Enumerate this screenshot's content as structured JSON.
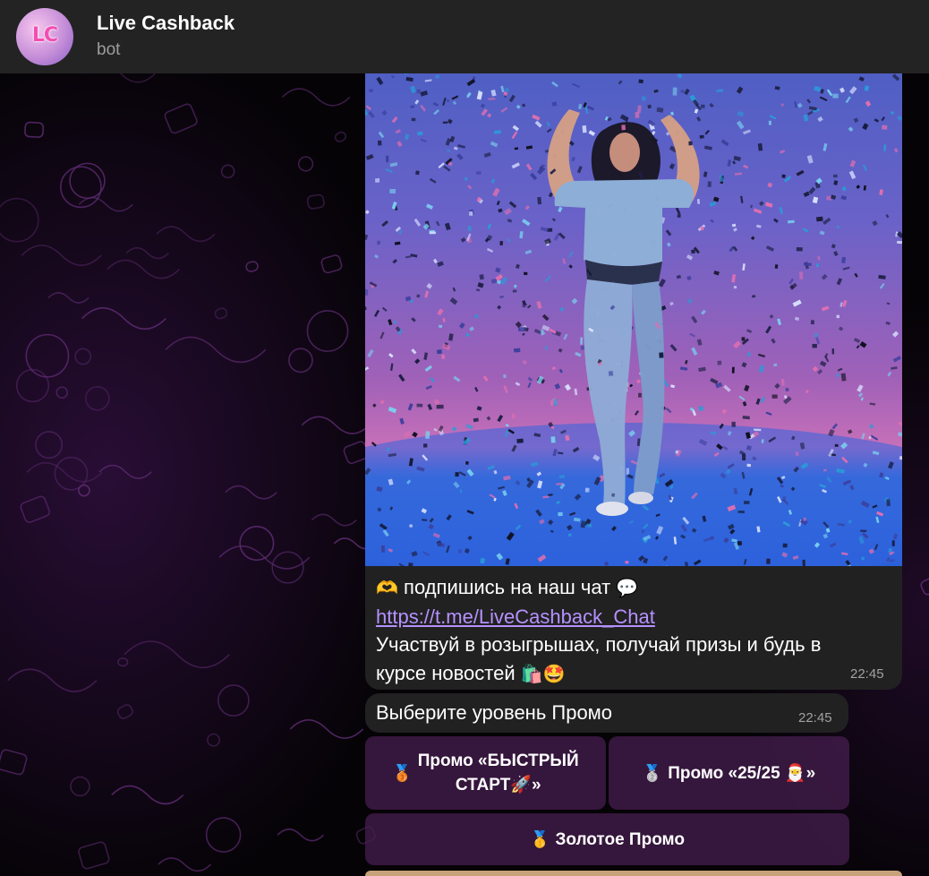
{
  "header": {
    "avatar_text": "LC",
    "title": "Live Cashback",
    "subtitle": "bot"
  },
  "photo_message": {
    "caption": {
      "line1_emoji": "🫶",
      "line1_text": "подпишись на наш чат",
      "line1_trailing_emoji": "💬",
      "link": "https://t.me/LiveCashback_Chat",
      "line3": "Участвуй в розыгрышах, получай призы и будь в",
      "line4_text": "курсе новостей",
      "line4_emoji": "🛍️🤩"
    },
    "time": "22:45"
  },
  "text_message": {
    "text": "Выберите уровень Промо",
    "time": "22:45"
  },
  "keyboard": {
    "buttons": [
      {
        "medal": "🥉",
        "label_line1": "Промо «БЫСТРЫЙ",
        "label_line2": "СТАРТ🚀»"
      },
      {
        "medal": "🥈",
        "label": "Промо «25/25 🎅»"
      },
      {
        "medal": "🥇",
        "label": "Золотое Промо"
      }
    ]
  },
  "colors": {
    "header_bg": "#232323",
    "bubble_bg": "#212121",
    "link": "#b591ff",
    "keyboard_button_bg": "#481e52",
    "timestamp": "#a2a2a2"
  }
}
